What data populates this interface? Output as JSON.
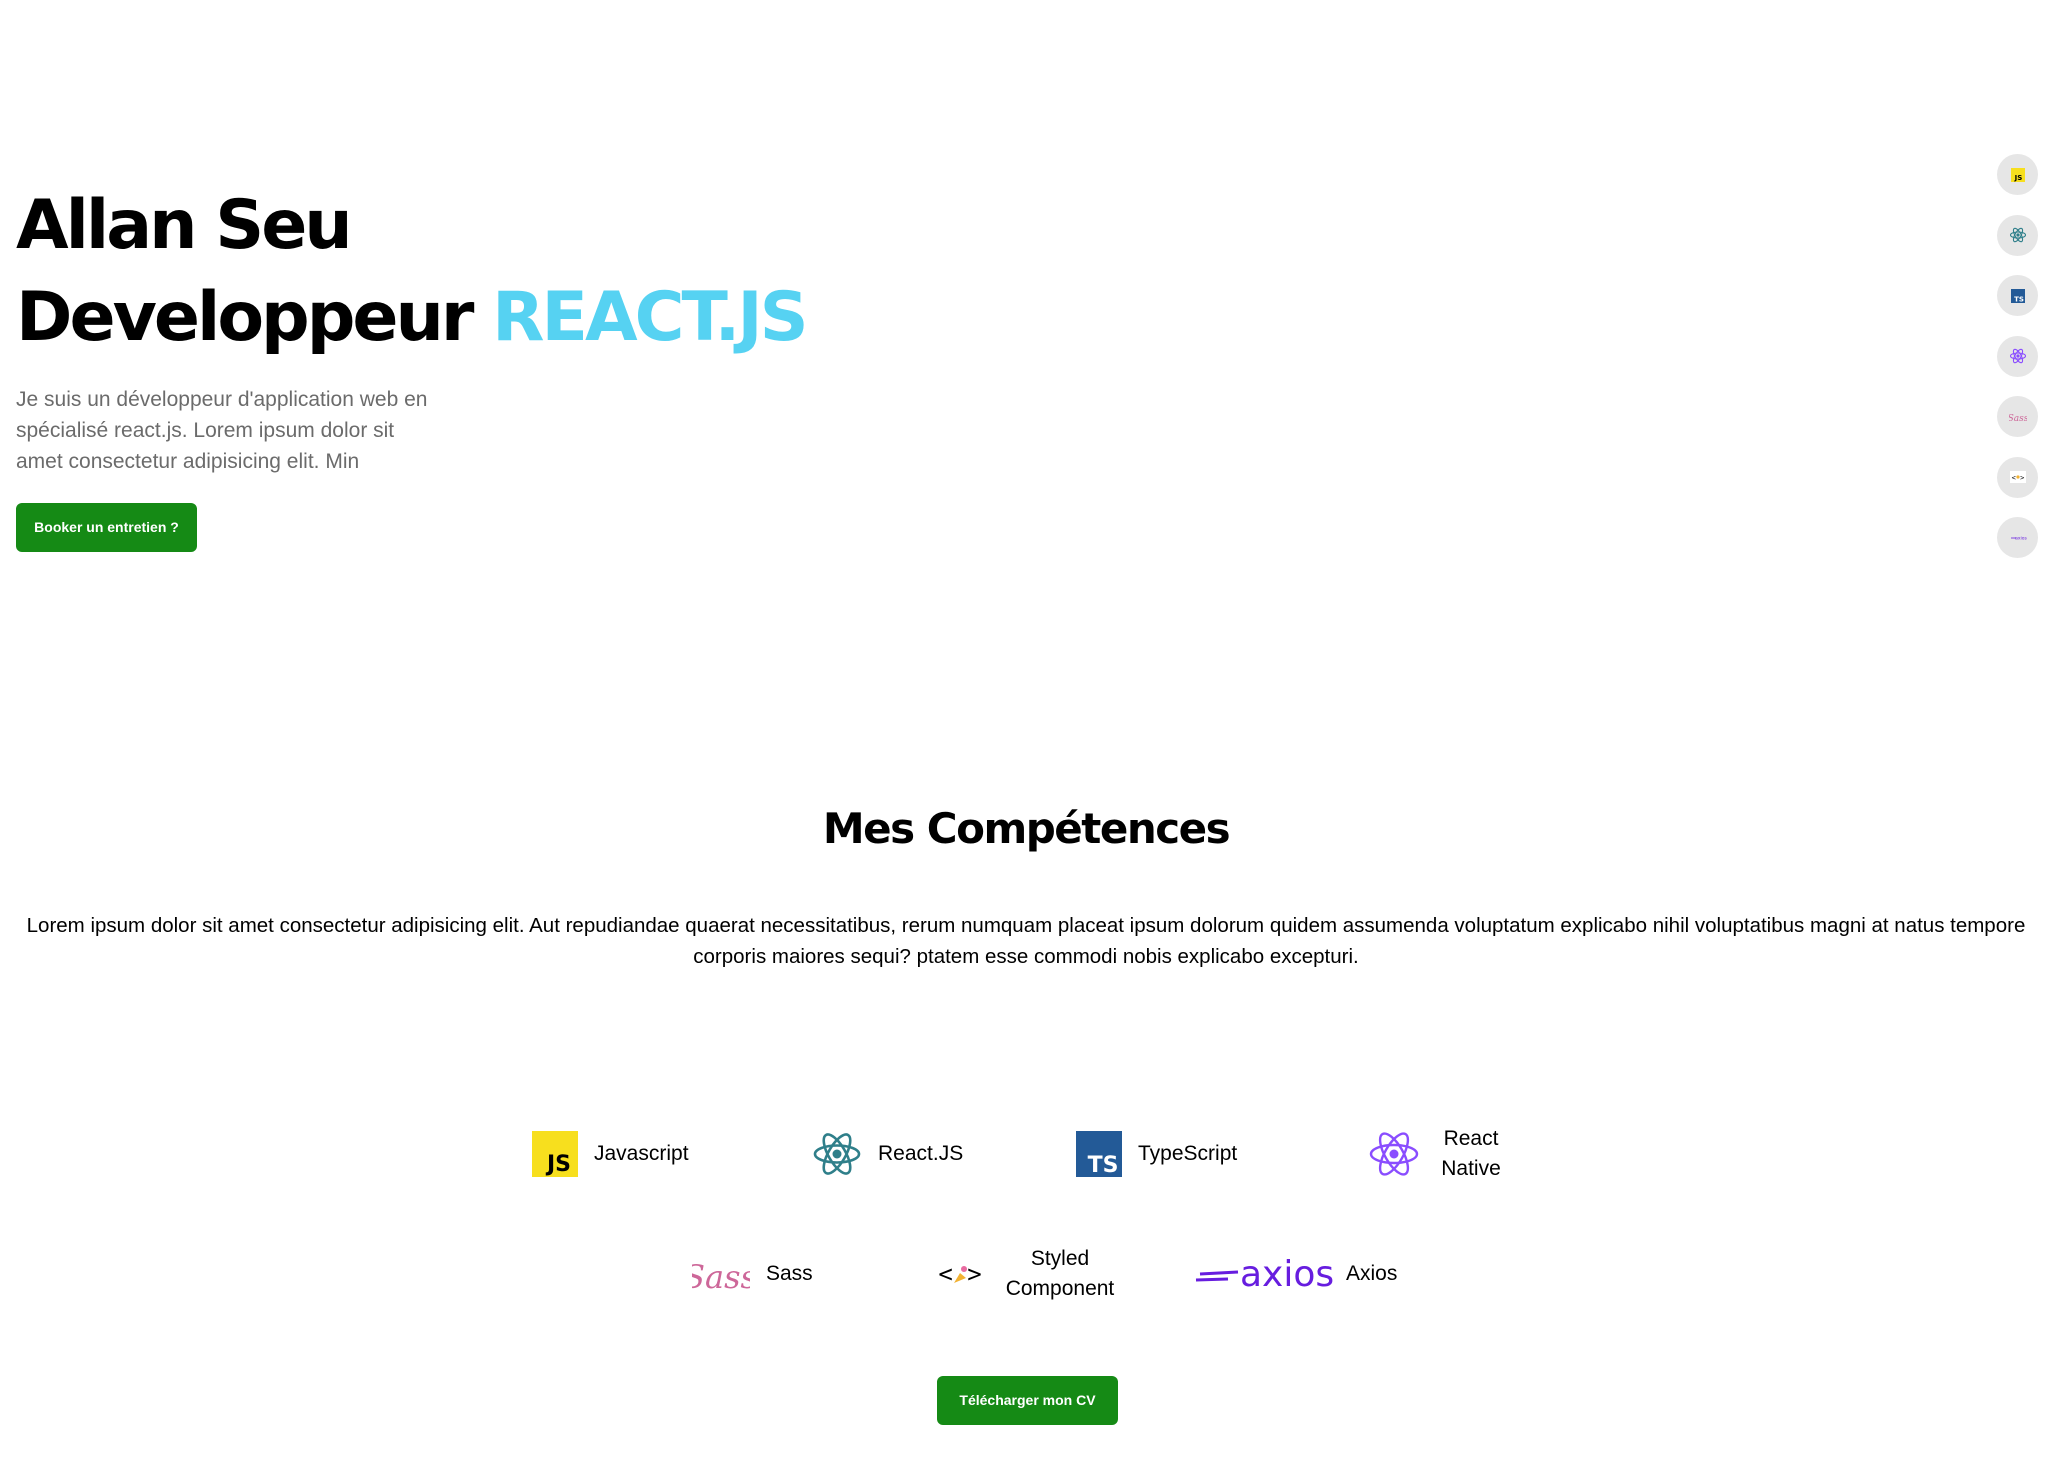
{
  "hero": {
    "name": "Allan Seu",
    "role_prefix": "Developpeur",
    "role_accent": "REACT.JS",
    "description": "Je suis un développeur d'application web en spécialisé react.js. Lorem ipsum dolor sit amet consectetur adipisicing elit. Min",
    "cta_label": "Booker un entretien ?"
  },
  "rail": {
    "items": [
      "javascript-icon",
      "react-icon",
      "typescript-icon",
      "react-native-icon",
      "sass-icon",
      "styled-component-icon",
      "axios-icon"
    ]
  },
  "skills": {
    "title": "Mes Compétences",
    "text": "Lorem ipsum dolor sit amet consectetur adipisicing elit. Aut repudiandae quaerat necessitatibus, rerum numquam placeat ipsum dolorum quidem assumenda voluptatum explicabo nihil voluptatibus magni at natus tempore corporis maiores sequi? ptatem esse commodi nobis explicabo excepturi.",
    "items": [
      {
        "label": "Javascript",
        "icon": "javascript-icon"
      },
      {
        "label": "React.JS",
        "icon": "react-icon"
      },
      {
        "label": "TypeScript",
        "icon": "typescript-icon"
      },
      {
        "label": "React Native",
        "icon": "react-native-icon"
      },
      {
        "label": "Sass",
        "icon": "sass-icon"
      },
      {
        "label": "Styled Component",
        "icon": "styled-component-icon"
      },
      {
        "label": "Axios",
        "icon": "axios-icon"
      }
    ],
    "axios_wordmark": "axios",
    "cv_label": "Télécharger mon CV"
  },
  "colors": {
    "accent": "#56d2f2",
    "button": "#158a15",
    "js_yellow": "#f7df1e",
    "ts_blue": "#235a97",
    "react_teal": "#2f7f8a",
    "react_native_purple": "#8a4dff",
    "sass_pink": "#cd6799",
    "axios_purple": "#671ddf"
  }
}
